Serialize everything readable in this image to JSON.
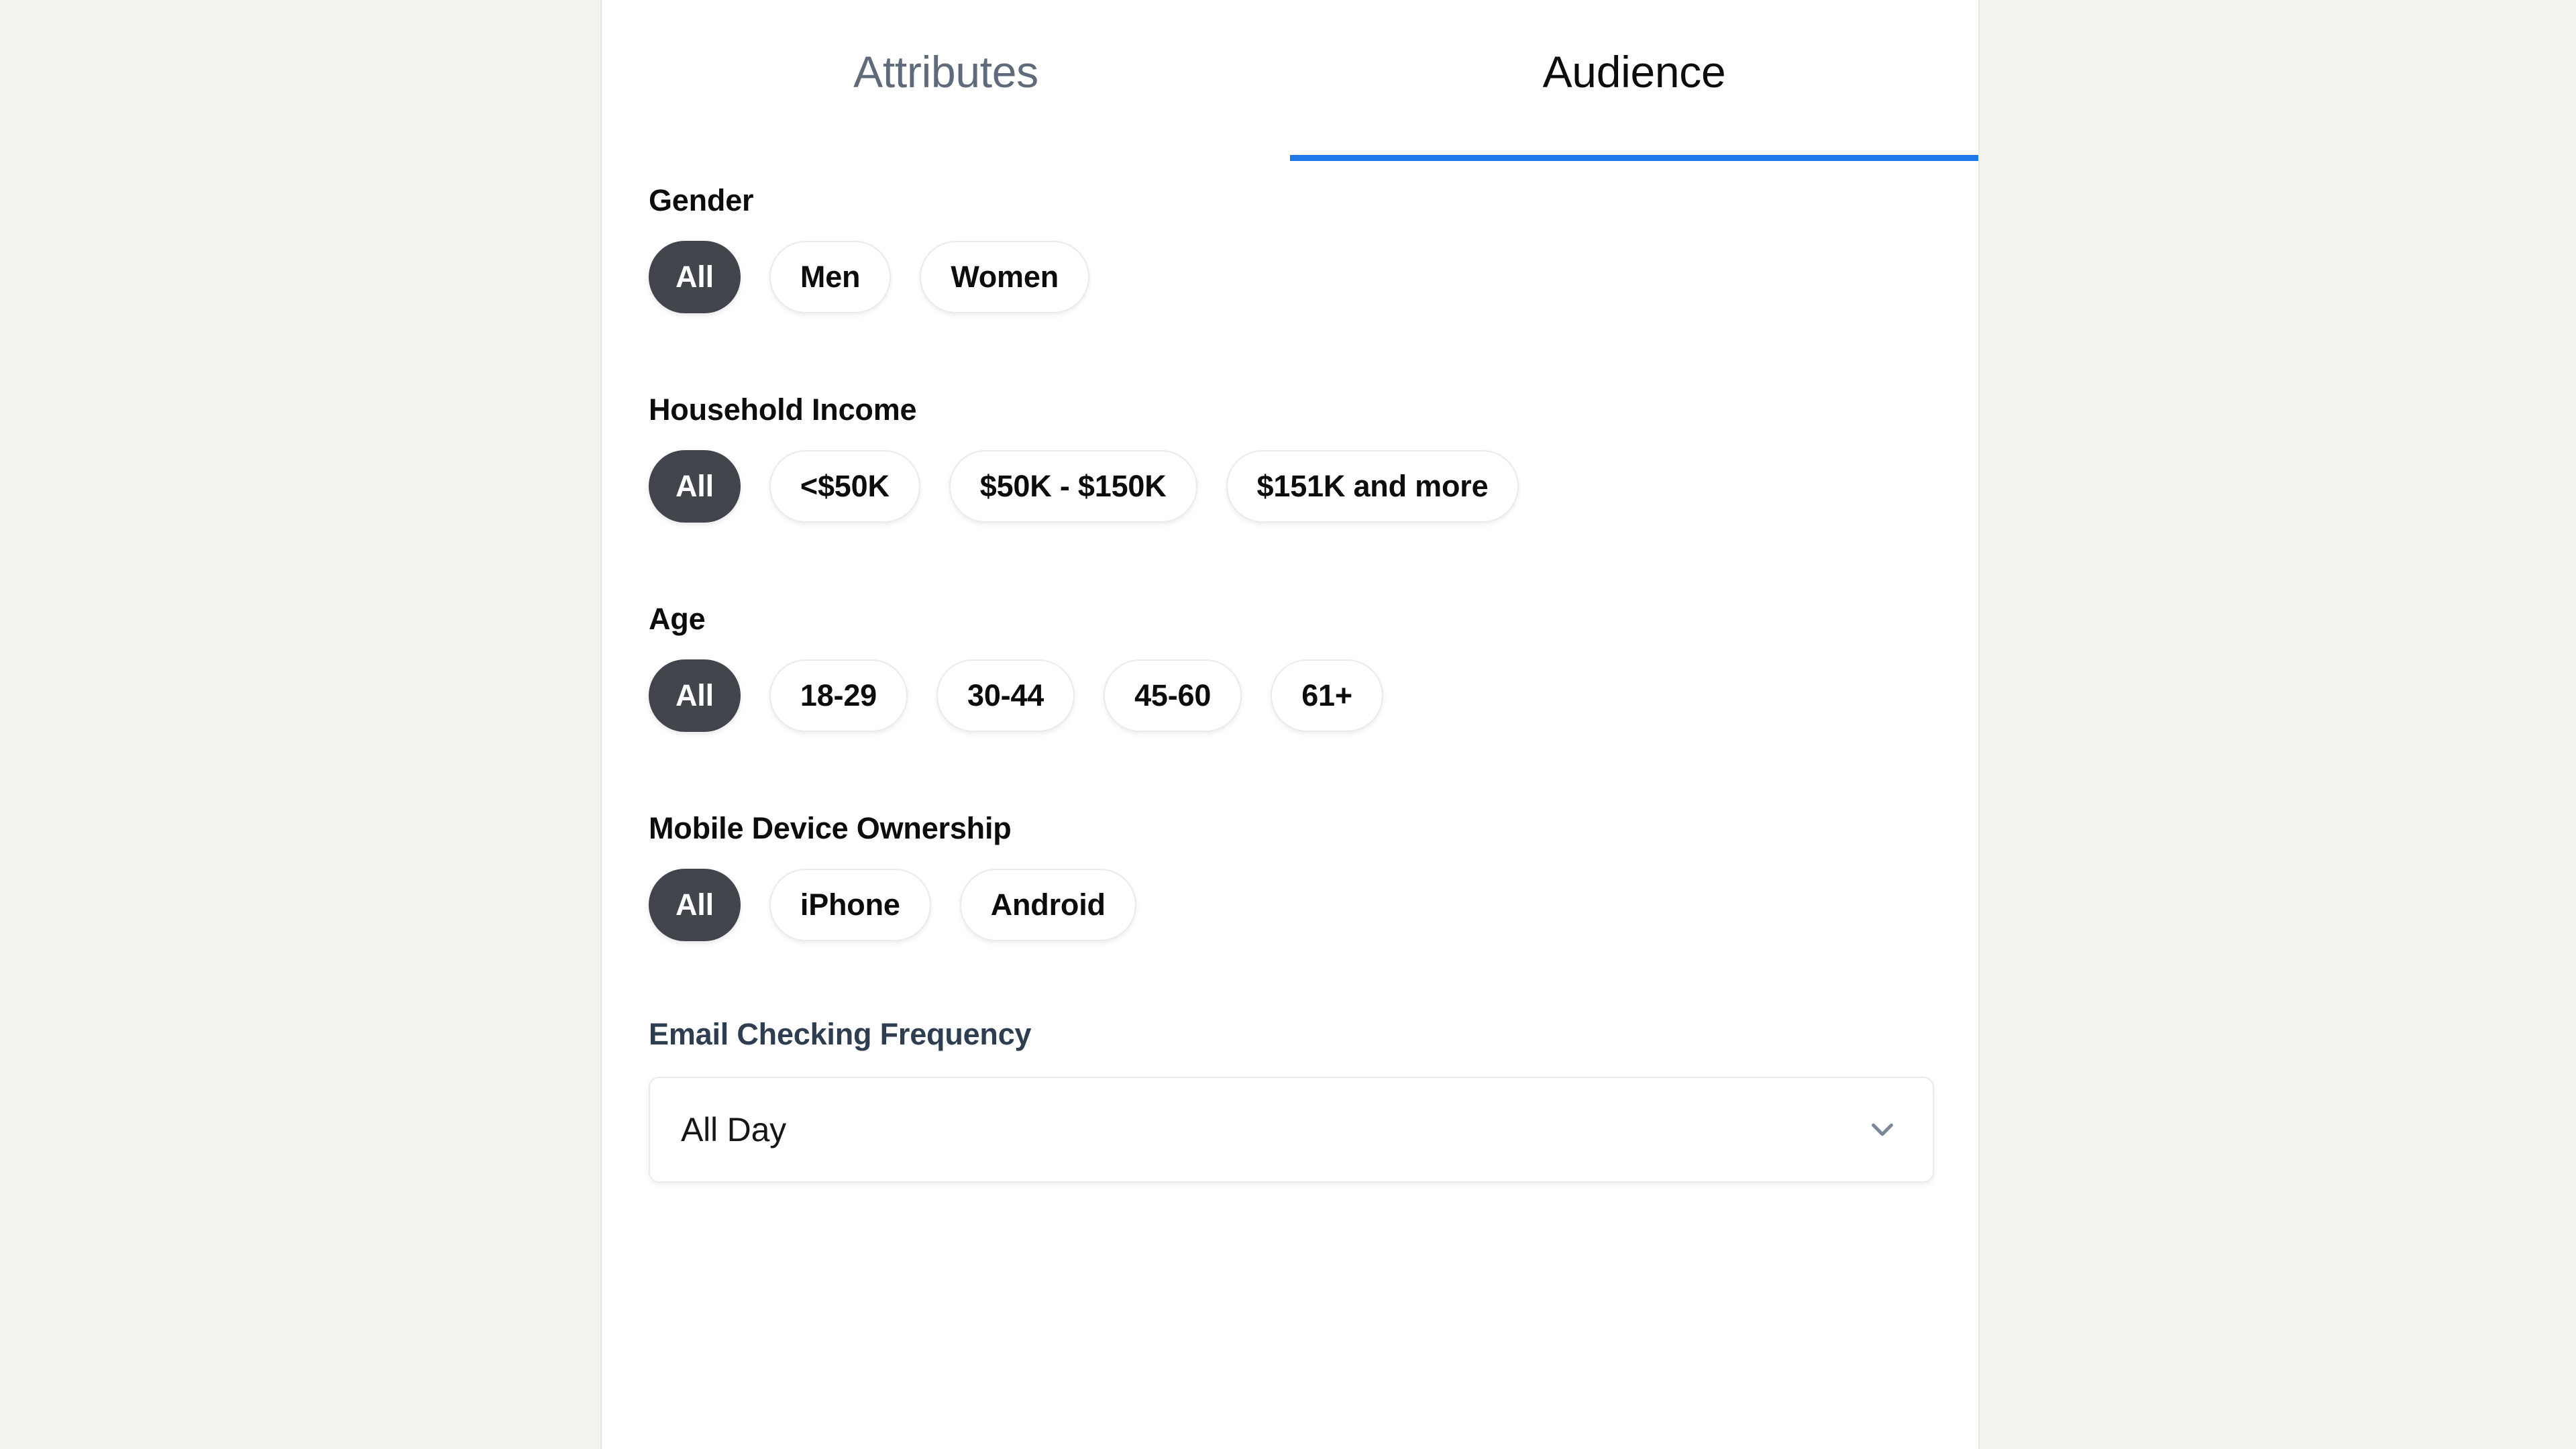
{
  "theme": {
    "page_background": "#f4f2ed",
    "panel_background": "#ffffff",
    "panel_border": "#e8e6e1",
    "active_tab_underline": "#1f78e8",
    "active_tab_text": "#0b0c0e",
    "inactive_tab_text": "#5f6b7a",
    "selected_pill_fill": "#42454c",
    "selected_pill_text": "#ffffff",
    "unselected_pill_fill": "#ffffff",
    "unselected_pill_text": "#0b0c0e",
    "unselected_pill_border": "#eceaea",
    "heading_text": "#0b0c0e",
    "slate_heading_text": "#2e3e50",
    "chevron_color": "#7a8699"
  },
  "tabs": [
    {
      "label": "Attributes",
      "active": false
    },
    {
      "label": "Audience",
      "active": true
    }
  ],
  "groups": [
    {
      "title": "Gender",
      "options": [
        {
          "label": "All",
          "selected": true
        },
        {
          "label": "Men",
          "selected": false
        },
        {
          "label": "Women",
          "selected": false
        }
      ]
    },
    {
      "title": "Household Income",
      "options": [
        {
          "label": "All",
          "selected": true
        },
        {
          "label": "<$50K",
          "selected": false
        },
        {
          "label": "$50K - $150K",
          "selected": false
        },
        {
          "label": "$151K and more",
          "selected": false
        }
      ]
    },
    {
      "title": "Age",
      "options": [
        {
          "label": "All",
          "selected": true
        },
        {
          "label": "18-29",
          "selected": false
        },
        {
          "label": "30-44",
          "selected": false
        },
        {
          "label": "45-60",
          "selected": false
        },
        {
          "label": "61+",
          "selected": false
        }
      ]
    },
    {
      "title": "Mobile Device Ownership",
      "options": [
        {
          "label": "All",
          "selected": true
        },
        {
          "label": "iPhone",
          "selected": false
        },
        {
          "label": "Android",
          "selected": false
        }
      ]
    }
  ],
  "email_frequency": {
    "title": "Email Checking Frequency",
    "selected_value": "All Day",
    "chevron_icon": "chevron-down-icon"
  }
}
